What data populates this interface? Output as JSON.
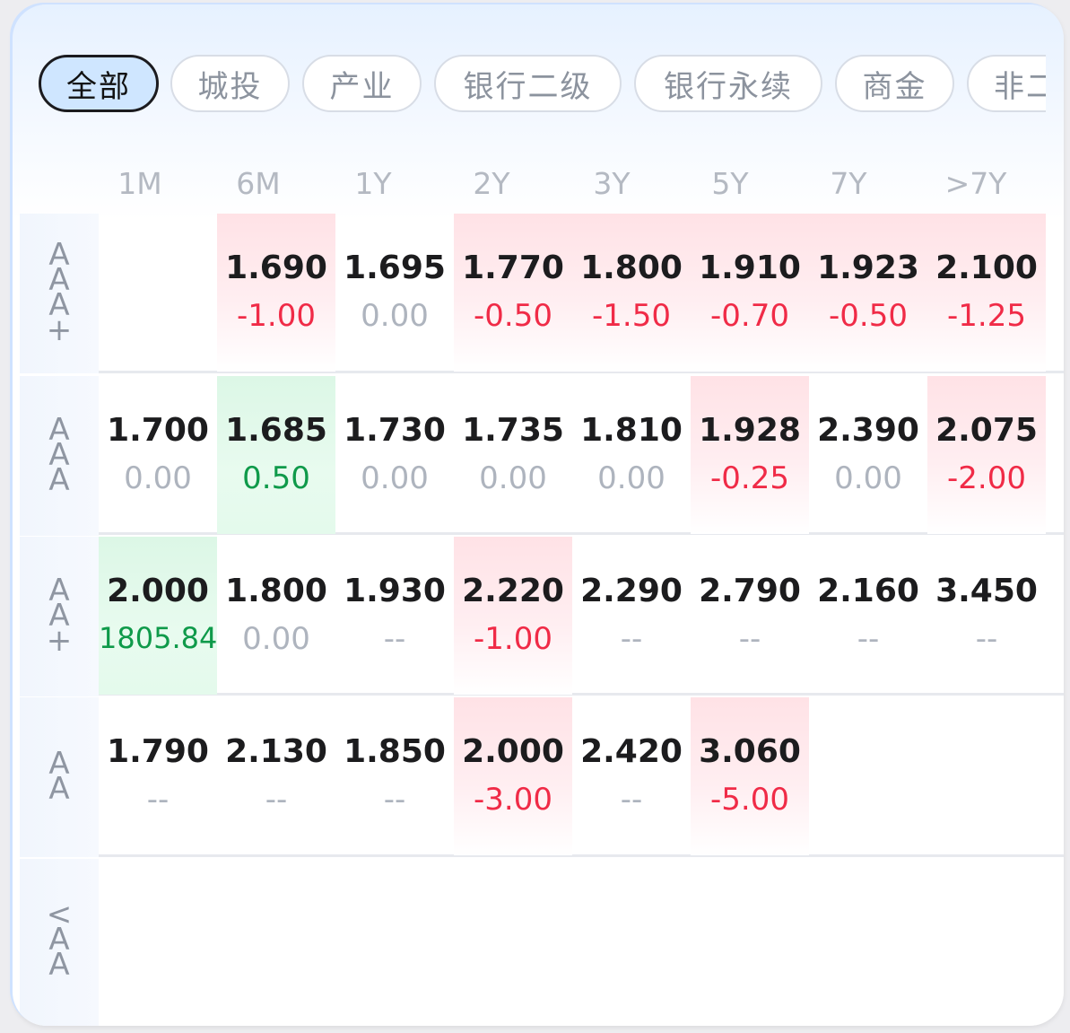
{
  "tabs": [
    "全部",
    "城投",
    "产业",
    "银行二级",
    "银行永续",
    "商金",
    "非二"
  ],
  "active_tab": "全部",
  "columns": [
    "1M",
    "6M",
    "1Y",
    "2Y",
    "3Y",
    "5Y",
    "7Y",
    ">7Y"
  ],
  "colors": {
    "up": "#f02b47",
    "down": "#0f9a4a",
    "neutral": "#aeb4be"
  },
  "rows": [
    {
      "label": [
        "A",
        "A",
        "A",
        "+"
      ],
      "cells": [
        null,
        {
          "v": "1.690",
          "d": "-1.00",
          "t": "neg"
        },
        {
          "v": "1.695",
          "d": "0.00",
          "t": "none"
        },
        {
          "v": "1.770",
          "d": "-0.50",
          "t": "neg"
        },
        {
          "v": "1.800",
          "d": "-1.50",
          "t": "neg"
        },
        {
          "v": "1.910",
          "d": "-0.70",
          "t": "neg"
        },
        {
          "v": "1.923",
          "d": "-0.50",
          "t": "neg"
        },
        {
          "v": "2.100",
          "d": "-1.25",
          "t": "neg"
        }
      ]
    },
    {
      "label": [
        "A",
        "A",
        "A"
      ],
      "cells": [
        {
          "v": "1.700",
          "d": "0.00",
          "t": "none"
        },
        {
          "v": "1.685",
          "d": "0.50",
          "t": "pos"
        },
        {
          "v": "1.730",
          "d": "0.00",
          "t": "none"
        },
        {
          "v": "1.735",
          "d": "0.00",
          "t": "none"
        },
        {
          "v": "1.810",
          "d": "0.00",
          "t": "none"
        },
        {
          "v": "1.928",
          "d": "-0.25",
          "t": "neg"
        },
        {
          "v": "2.390",
          "d": "0.00",
          "t": "none"
        },
        {
          "v": "2.075",
          "d": "-2.00",
          "t": "neg"
        }
      ]
    },
    {
      "label": [
        "A",
        "A",
        "+"
      ],
      "cells": [
        {
          "v": "2.000",
          "d": "1805.84",
          "t": "pos"
        },
        {
          "v": "1.800",
          "d": "0.00",
          "t": "none"
        },
        {
          "v": "1.930",
          "d": "--",
          "t": "none"
        },
        {
          "v": "2.220",
          "d": "-1.00",
          "t": "neg"
        },
        {
          "v": "2.290",
          "d": "--",
          "t": "none"
        },
        {
          "v": "2.790",
          "d": "--",
          "t": "none"
        },
        {
          "v": "2.160",
          "d": "--",
          "t": "none"
        },
        {
          "v": "3.450",
          "d": "--",
          "t": "none"
        }
      ]
    },
    {
      "label": [
        "A",
        "A"
      ],
      "cells": [
        {
          "v": "1.790",
          "d": "--",
          "t": "none"
        },
        {
          "v": "2.130",
          "d": "--",
          "t": "none"
        },
        {
          "v": "1.850",
          "d": "--",
          "t": "none"
        },
        {
          "v": "2.000",
          "d": "-3.00",
          "t": "neg"
        },
        {
          "v": "2.420",
          "d": "--",
          "t": "none"
        },
        {
          "v": "3.060",
          "d": "-5.00",
          "t": "neg"
        },
        null,
        null
      ]
    },
    {
      "label": [
        "<",
        "A",
        "A"
      ],
      "cells": [
        null,
        null,
        null,
        null,
        null,
        null,
        null,
        null
      ]
    }
  ]
}
